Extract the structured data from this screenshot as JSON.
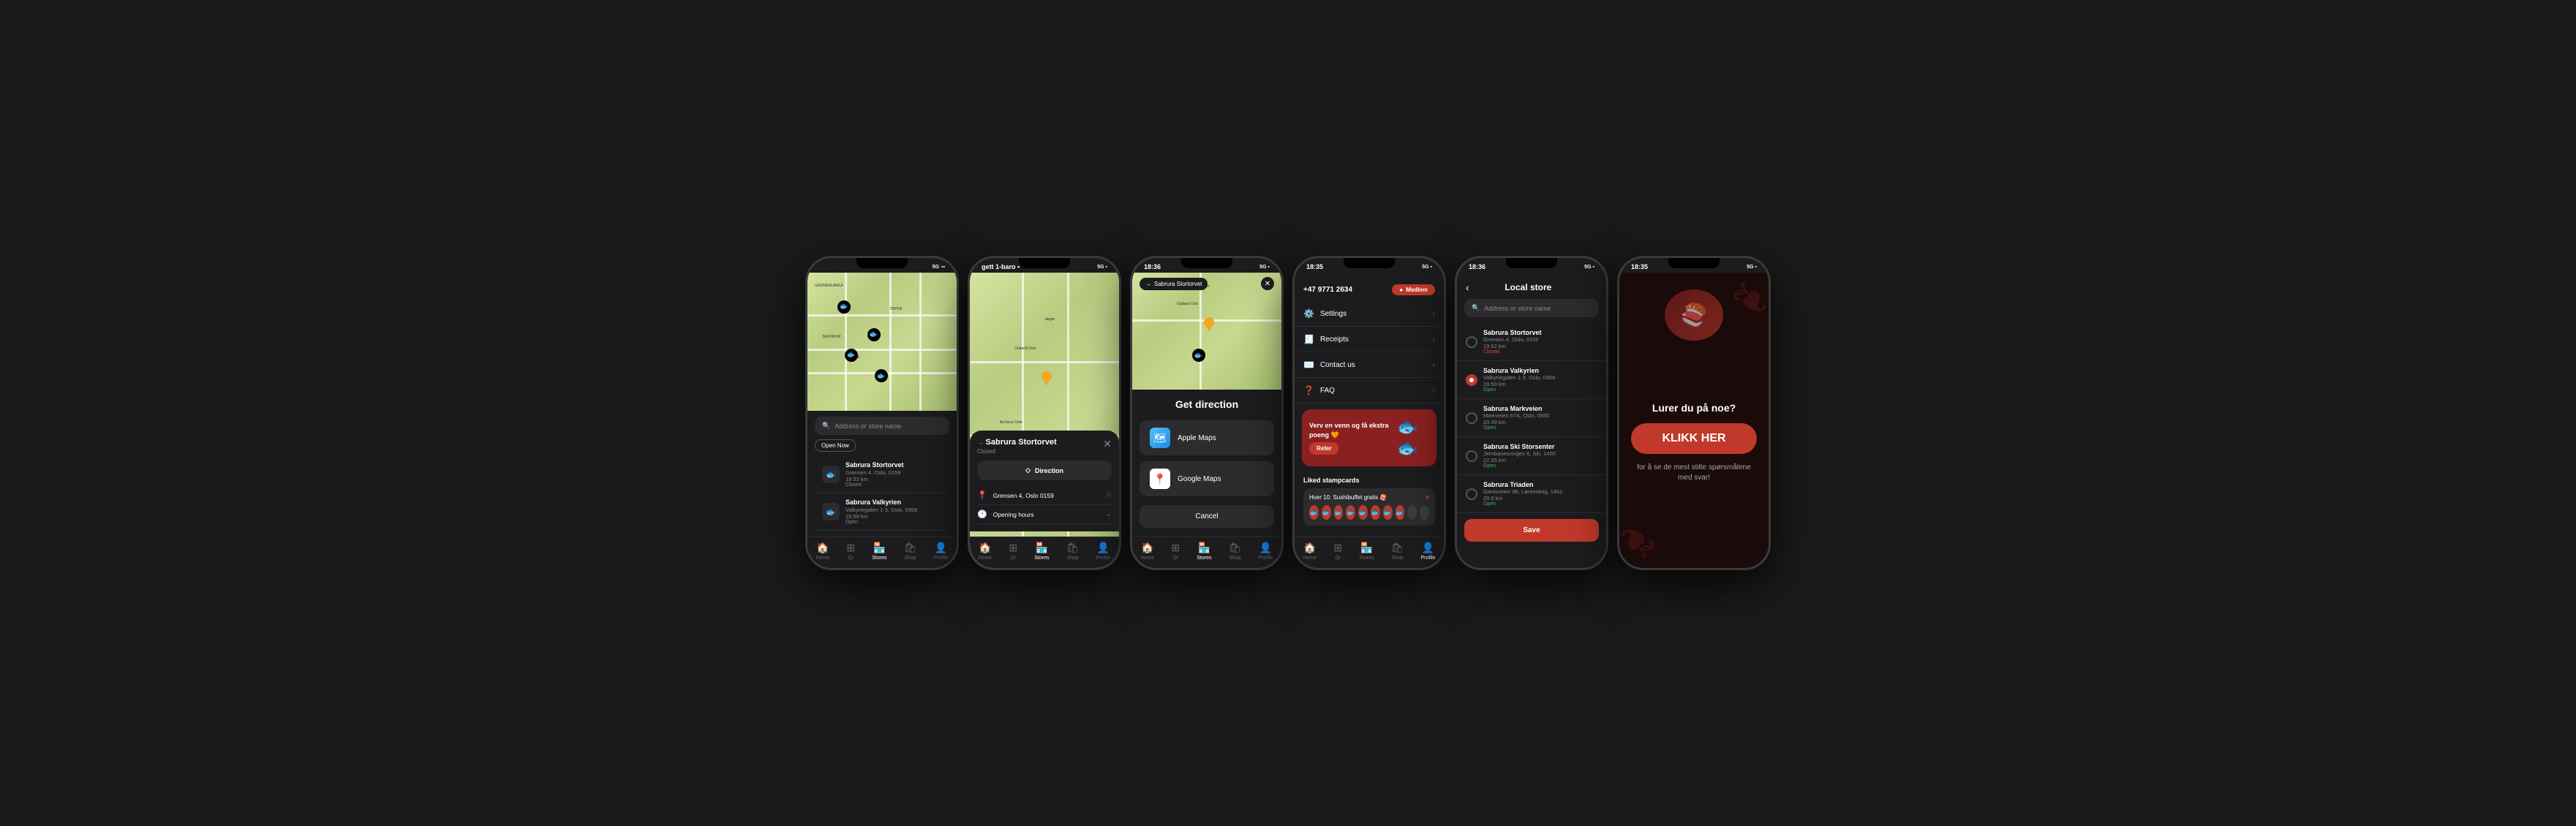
{
  "phones": [
    {
      "id": "phone1",
      "statusBar": {
        "time": "",
        "icons": "5G ▪ ▪"
      },
      "screen": "map-stores",
      "searchPlaceholder": "Address or store name",
      "openNow": "Open Now",
      "stores": [
        {
          "name": "Sabrura Stortorvet",
          "address": "Grensen 4, Oslo, 0159",
          "distance": "19.52 km",
          "status": "Closed"
        },
        {
          "name": "Sabrura Valkyrien",
          "address": "Valkyriegaten 1-3, Oslo, 0366",
          "distance": "19.59 km",
          "status": "Open"
        }
      ],
      "navItems": [
        {
          "icon": "🏠",
          "label": "Home",
          "active": false
        },
        {
          "icon": "⊞",
          "label": "Qr",
          "active": false
        },
        {
          "icon": "🏪",
          "label": "Stores",
          "active": true
        },
        {
          "icon": "🛍",
          "label": "Shop",
          "active": false
        },
        {
          "icon": "👤",
          "label": "Profile",
          "active": false
        }
      ]
    },
    {
      "id": "phone2",
      "statusBar": {
        "time": "gett 1-baro ▪",
        "icons": ""
      },
      "screen": "store-detail",
      "storeName": "Sabrura Stortorvet",
      "storeStatus": "Closed",
      "directionLabel": "Direction",
      "address": "Grensen 4, Oslo 0159",
      "openingHours": "Opening hours",
      "navItems": [
        {
          "icon": "🏠",
          "label": "Home",
          "active": false
        },
        {
          "icon": "⊞",
          "label": "Qr",
          "active": false
        },
        {
          "icon": "🏪",
          "label": "Stores",
          "active": true
        },
        {
          "icon": "🛍",
          "label": "Shop",
          "active": false
        },
        {
          "icon": "👤",
          "label": "Profile",
          "active": false
        }
      ]
    },
    {
      "id": "phone3",
      "statusBar": {
        "time": "18:36",
        "icons": "5G ▪"
      },
      "screen": "get-direction",
      "storeName": "Sabrura Stortorvet",
      "title": "Get direction",
      "appleMaps": "Apple Maps",
      "googleMaps": "Google Maps",
      "cancelLabel": "Cancel",
      "navItems": [
        {
          "icon": "🏠",
          "label": "Home",
          "active": false
        },
        {
          "icon": "⊞",
          "label": "Qr",
          "active": false
        },
        {
          "icon": "🏪",
          "label": "Stores",
          "active": true
        },
        {
          "icon": "🛍",
          "label": "Shop",
          "active": false
        },
        {
          "icon": "👤",
          "label": "Profile",
          "active": false
        }
      ]
    },
    {
      "id": "phone4",
      "statusBar": {
        "time": "18:35",
        "icons": "5G ▪"
      },
      "screen": "profile-menu",
      "phoneNumber": "+47 9771 2634",
      "memberLabel": "Medlem",
      "menuItems": [
        {
          "icon": "⚙️",
          "label": "Settings"
        },
        {
          "icon": "🧾",
          "label": "Receipts"
        },
        {
          "icon": "✉️",
          "label": "Contact us"
        },
        {
          "icon": "❓",
          "label": "FAQ"
        }
      ],
      "promoText": "Verv en venn og få\nekstra poeng 🧡",
      "referLabel": "Refer",
      "likedStampcards": "Liked stampcards",
      "stampCardTitle": "Hver 10. Sushibuffet gratis 🍣",
      "stamps": 8,
      "totalStamps": 10,
      "navItems": [
        {
          "icon": "🏠",
          "label": "Home",
          "active": false
        },
        {
          "icon": "⊞",
          "label": "Qr",
          "active": false
        },
        {
          "icon": "🏪",
          "label": "Stores",
          "active": false
        },
        {
          "icon": "🛍",
          "label": "Shop",
          "active": false
        },
        {
          "icon": "👤",
          "label": "Profile",
          "active": true
        }
      ]
    },
    {
      "id": "phone5",
      "statusBar": {
        "time": "18:36",
        "icons": "5G ▪"
      },
      "screen": "local-store",
      "backLabel": "‹",
      "screenTitle": "Local store",
      "searchPlaceholder": "Address or store name",
      "stores": [
        {
          "name": "Sabrura Stortorvet",
          "address": "Grensen 4, Oslo, 0159",
          "distance": "19.52 km",
          "status": "Closed",
          "selected": false
        },
        {
          "name": "Sabrura Valkyrien",
          "address": "Valkyriegaten 1-3, Oslo, 0366",
          "distance": "19.59 km",
          "status": "Open",
          "selected": true
        },
        {
          "name": "Sabrura Markveien",
          "address": "Markveien 67A, Oslo, 0550",
          "distance": "20.49 km",
          "status": "Open",
          "selected": false
        },
        {
          "name": "Sabrura Ski Storsenter",
          "address": "Jernbanesvingen 6, Ski, 1400",
          "distance": "22.35 km",
          "status": "Open",
          "selected": false
        },
        {
          "name": "Sabrura Triaden",
          "address": "Ganisveien 88, Lørenskog, 1461",
          "distance": "29.9 km",
          "status": "Open",
          "selected": false
        }
      ],
      "saveLabel": "Save"
    },
    {
      "id": "phone6",
      "statusBar": {
        "time": "18:35",
        "icons": "5G ▪"
      },
      "screen": "ad",
      "question": "Lurer du på noe?",
      "ctaLabel": "KLIKK HER",
      "subtitle": "for å se de mest stilte\nspørsmålene med svar!"
    }
  ]
}
